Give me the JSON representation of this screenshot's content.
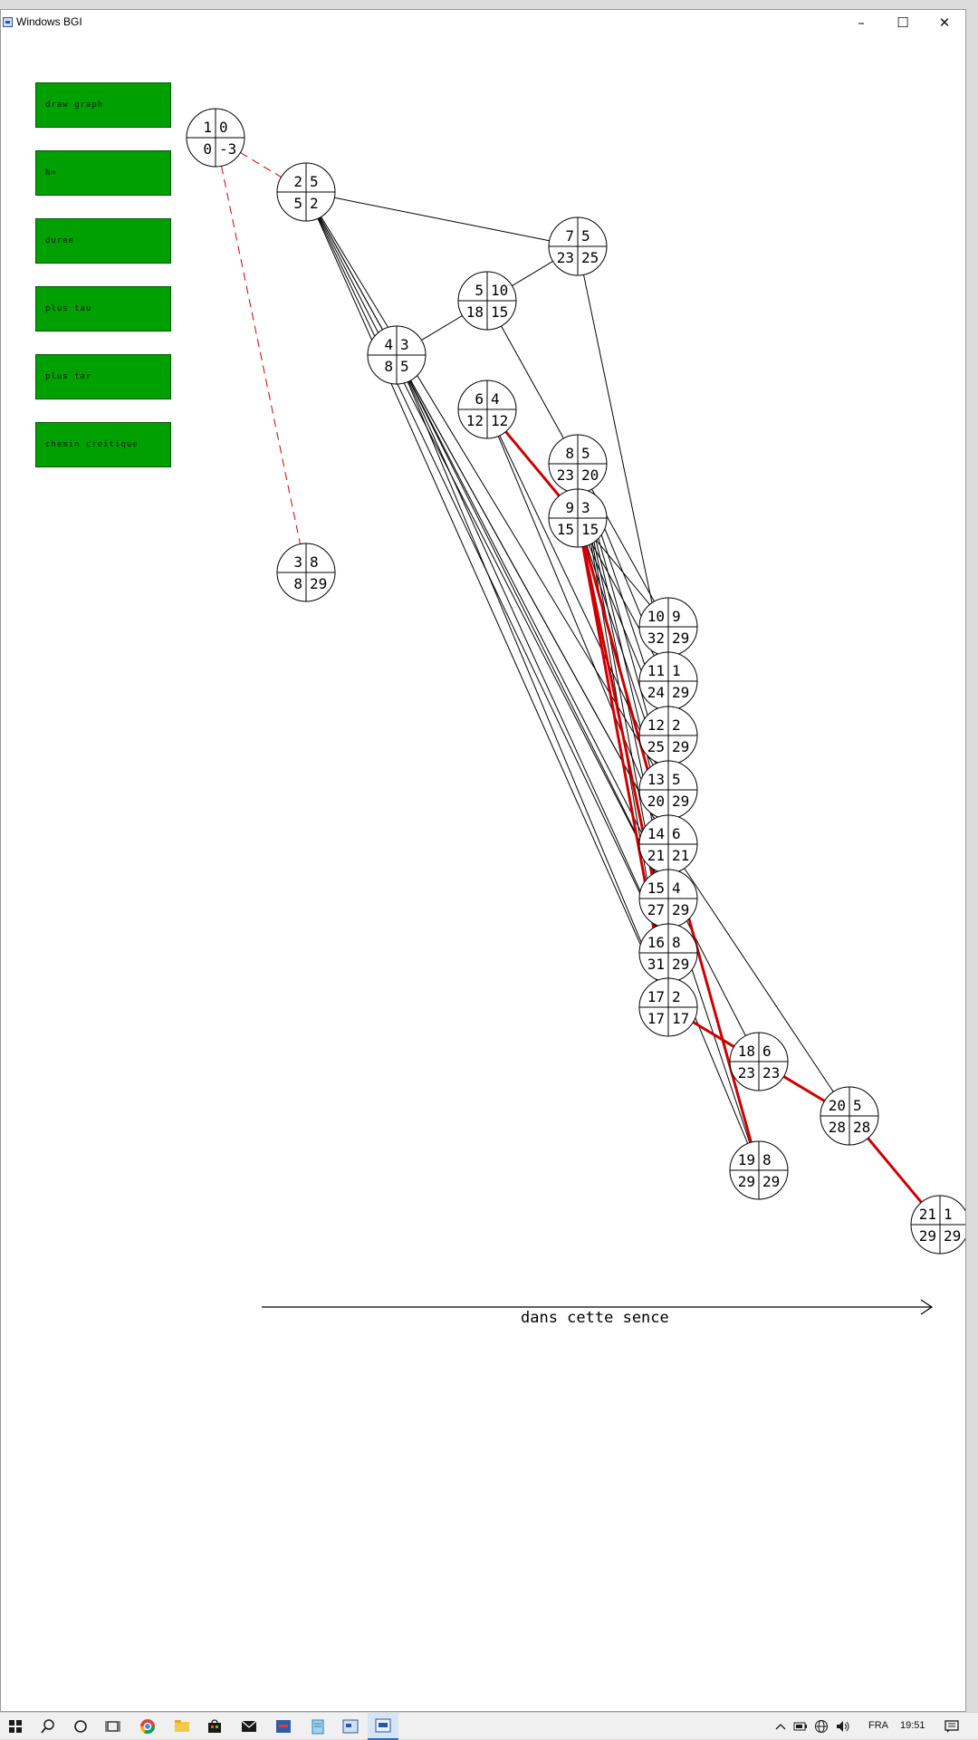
{
  "window": {
    "title": "Windows BGI"
  },
  "controls": {
    "minimize_icon": "minimize-icon",
    "maximize_icon": "maximize-icon",
    "close_icon": "close-icon"
  },
  "menu": [
    {
      "key": "draw",
      "label": "draw graph"
    },
    {
      "key": "n",
      "label": "N="
    },
    {
      "key": "duree",
      "label": "duree"
    },
    {
      "key": "tot",
      "label": "plus tau"
    },
    {
      "key": "tard",
      "label": "plus tar"
    },
    {
      "key": "critique",
      "label": "chemin creitique"
    }
  ],
  "direction_label": "dans cette sence",
  "colors": {
    "button": "#00a000",
    "critical": "#cc0000",
    "edge": "#000000"
  },
  "nodes": [
    {
      "id": "1",
      "duration": "0",
      "early": "0",
      "late": "-3"
    },
    {
      "id": "2",
      "duration": "5",
      "early": "5",
      "late": "2"
    },
    {
      "id": "3",
      "duration": "8",
      "early": "8",
      "late": "29"
    },
    {
      "id": "4",
      "duration": "3",
      "early": "8",
      "late": "5"
    },
    {
      "id": "5",
      "duration": "10",
      "early": "18",
      "late": "15"
    },
    {
      "id": "6",
      "duration": "4",
      "early": "12",
      "late": "12"
    },
    {
      "id": "7",
      "duration": "5",
      "early": "23",
      "late": "25"
    },
    {
      "id": "8",
      "duration": "5",
      "early": "23",
      "late": "20"
    },
    {
      "id": "9",
      "duration": "3",
      "early": "15",
      "late": "15"
    },
    {
      "id": "10",
      "duration": "9",
      "early": "32",
      "late": "29"
    },
    {
      "id": "11",
      "duration": "1",
      "early": "24",
      "late": "29"
    },
    {
      "id": "12",
      "duration": "2",
      "early": "25",
      "late": "29"
    },
    {
      "id": "13",
      "duration": "5",
      "early": "20",
      "late": "29"
    },
    {
      "id": "14",
      "duration": "6",
      "early": "21",
      "late": "21"
    },
    {
      "id": "15",
      "duration": "4",
      "early": "27",
      "late": "29"
    },
    {
      "id": "16",
      "duration": "8",
      "early": "31",
      "late": "29"
    },
    {
      "id": "17",
      "duration": "2",
      "early": "17",
      "late": "17"
    },
    {
      "id": "18",
      "duration": "6",
      "early": "23",
      "late": "23"
    },
    {
      "id": "19",
      "duration": "8",
      "early": "29",
      "late": "29"
    },
    {
      "id": "20",
      "duration": "5",
      "early": "28",
      "late": "28"
    },
    {
      "id": "21",
      "duration": "1",
      "early": "29",
      "late": "29"
    }
  ],
  "edges": [
    [
      "2",
      "7"
    ],
    [
      "2",
      "4"
    ],
    [
      "2",
      "13"
    ],
    [
      "2",
      "14"
    ],
    [
      "2",
      "15"
    ],
    [
      "2",
      "16"
    ],
    [
      "2",
      "17"
    ],
    [
      "4",
      "5"
    ],
    [
      "4",
      "14"
    ],
    [
      "4",
      "15"
    ],
    [
      "4",
      "16"
    ],
    [
      "4",
      "17"
    ],
    [
      "4",
      "18"
    ],
    [
      "5",
      "7"
    ],
    [
      "5",
      "8"
    ],
    [
      "6",
      "13"
    ],
    [
      "6",
      "14"
    ],
    [
      "7",
      "11"
    ],
    [
      "8",
      "10"
    ],
    [
      "8",
      "11"
    ],
    [
      "8",
      "12"
    ],
    [
      "8",
      "13"
    ],
    [
      "8",
      "14"
    ],
    [
      "8",
      "15"
    ],
    [
      "8",
      "16"
    ],
    [
      "8",
      "17"
    ],
    [
      "9",
      "10"
    ],
    [
      "9",
      "11"
    ],
    [
      "9",
      "12"
    ],
    [
      "9",
      "13"
    ],
    [
      "14",
      "20"
    ],
    [
      "15",
      "19"
    ],
    [
      "16",
      "19"
    ],
    [
      "20",
      "21"
    ]
  ],
  "critical_edges": [
    [
      "6",
      "9"
    ],
    [
      "9",
      "14"
    ],
    [
      "9",
      "16"
    ],
    [
      "9",
      "17"
    ],
    [
      "14",
      "19"
    ],
    [
      "17",
      "18"
    ],
    [
      "18",
      "20"
    ],
    [
      "20",
      "21"
    ]
  ],
  "dashed_edges": [
    [
      "1",
      "2"
    ],
    [
      "1",
      "3"
    ]
  ],
  "taskbar": {
    "language": "FRA",
    "time": "19:51",
    "icons": [
      "windows-start-icon",
      "search-icon",
      "cortana-icon",
      "task-view-icon",
      "chrome-icon",
      "file-explorer-icon",
      "store-icon",
      "mail-icon",
      "app-icon",
      "notepad-icon",
      "bgi-app-icon",
      "bgi-window-icon"
    ],
    "tray_icons": [
      "chevron-up-icon",
      "battery-icon",
      "network-icon",
      "volume-icon",
      "notification-icon"
    ]
  }
}
